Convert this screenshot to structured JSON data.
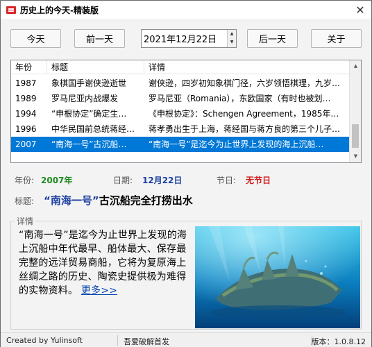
{
  "window": {
    "title": "历史上的今天-精装版",
    "close_glyph": "✕"
  },
  "toolbar": {
    "today": "今天",
    "prev_day": "前一天",
    "date_value": "2021年12月22日",
    "next_day": "后一天",
    "about": "关于"
  },
  "table": {
    "columns": [
      "年份",
      "标题",
      "详情"
    ],
    "rows": [
      {
        "year": "1987",
        "title": "象棋国手谢侠逊逝世",
        "detail": "谢侠逊，四岁初知象棋门径，六岁领悟棋理，九岁…"
      },
      {
        "year": "1989",
        "title": "罗马尼亚内战爆发",
        "detail": "罗马尼亚（Romania），东欧国家（有时也被划…"
      },
      {
        "year": "1994",
        "title": "“申根协定”确定生…",
        "detail": "《申根协定》：Schengen Agreement，1985年…"
      },
      {
        "year": "1996",
        "title": "中华民国前总统蒋经…",
        "detail": "蒋孝勇出生于上海，蒋经国与蒋方良的第三个儿子…"
      },
      {
        "year": "2007",
        "title": "“南海一号”古沉船…",
        "detail": "“南海一号”是迄今为止世界上发现的海上沉船…"
      }
    ],
    "selected_index": 4
  },
  "info": {
    "year_label": "年份:",
    "year_value": "2007年",
    "date_label": "日期:",
    "date_value": "12月22日",
    "holiday_label": "节日:",
    "holiday_value": "无节日",
    "title_label": "标题:",
    "title_highlight": "“南海一号”",
    "title_rest": "古沉船完全打捞出水"
  },
  "detail": {
    "group_label": "详情",
    "text": "“南海一号”是迄今为止世界上发现的海上沉船中年代最早、船体最大、保存最完整的远洋贸易商船，它将为复原海上丝绸之路的历史、陶瓷史提供极为难得的实物资料。",
    "more_link": "更多>>"
  },
  "status": {
    "left": "Created by Yulinsoft",
    "middle": "吾爱破解首发",
    "right": "版本：1.0.8.12"
  },
  "colors": {
    "selection": "#0078d7",
    "year_value": "#1e8a1e",
    "date_value": "#1a3fa0",
    "holiday_value": "#d11a1a",
    "title_highlight": "#1a3fa0",
    "link": "#0645ad"
  }
}
